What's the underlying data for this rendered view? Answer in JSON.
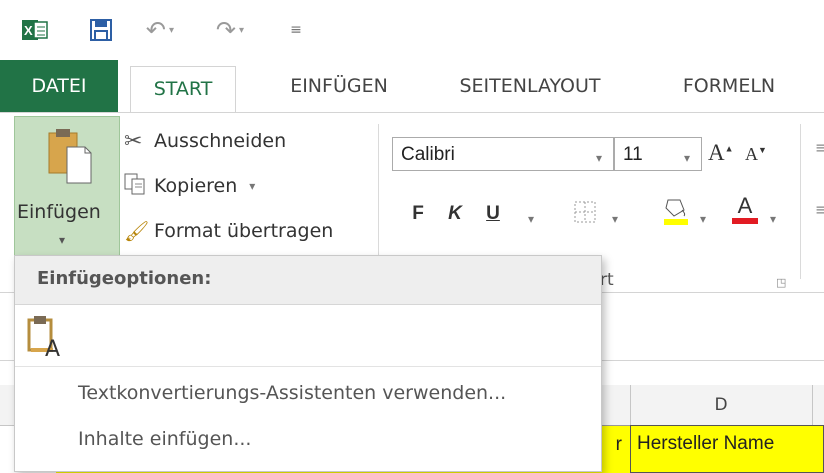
{
  "qat": {
    "excel_icon": "excel-logo-icon",
    "save_icon": "save-icon",
    "undo_icon": "undo-icon",
    "redo_icon": "redo-icon",
    "customize_icon": "customize-qat-icon"
  },
  "tabs": [
    {
      "label": "DATEI"
    },
    {
      "label": "START"
    },
    {
      "label": "EINFÜGEN"
    },
    {
      "label": "SEITENLAYOUT"
    },
    {
      "label": "FORMELN"
    }
  ],
  "clipboard": {
    "paste_label": "Einfügen",
    "cut_label": "Ausschneiden",
    "copy_label": "Kopieren",
    "format_painter_label": "Format übertragen"
  },
  "font": {
    "name": "Calibri",
    "size": "11",
    "grow_label": "A",
    "shrink_label": "A",
    "bold_label": "F",
    "italic_label": "K",
    "underline_label": "U",
    "font_color_label": "A",
    "group_label_fragment": "rt"
  },
  "paste_menu": {
    "header": "Einfügeoptionen:",
    "option_icon": "paste-text-only-icon",
    "items": [
      {
        "label": "Textkonvertierungs-Assistenten verwenden..."
      },
      {
        "label": "Inhalte einfügen..."
      }
    ]
  },
  "sheet": {
    "column_d_header": "D",
    "cell_c_fragment": "r",
    "cell_d_value": "Hersteller Name"
  },
  "colors": {
    "accent": "#217346",
    "paste_bg": "#c7dfc2",
    "cell_highlight": "#ffff00",
    "font_color_bar": "#e21b23",
    "fill_color_bar": "#ffff00"
  }
}
